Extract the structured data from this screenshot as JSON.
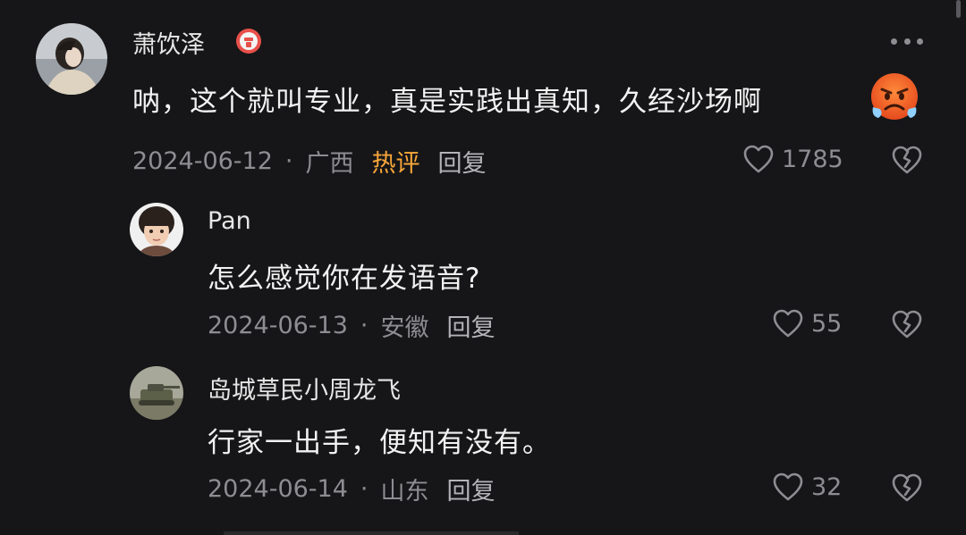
{
  "comments": [
    {
      "username": "萧饮泽",
      "text": "呐，这个就叫专业，真是实践出真知，久经沙场啊",
      "emoji": "angry-face-emoji",
      "date": "2024-06-12",
      "separator": "·",
      "location": "广西",
      "hot_label": "热评",
      "reply_label": "回复",
      "likes": "1785"
    },
    {
      "username": "Pan",
      "text": "怎么感觉你在发语音?",
      "date": "2024-06-13",
      "separator": "·",
      "location": "安徽",
      "reply_label": "回复",
      "likes": "55"
    },
    {
      "username": "岛城草民小周龙飞",
      "text": "行家一出手，便知有没有。",
      "date": "2024-06-14",
      "separator": "·",
      "location": "山东",
      "reply_label": "回复",
      "likes": "32"
    }
  ],
  "colors": {
    "background": "#161618",
    "hot": "#f7a63a",
    "meta": "#8d8d92"
  }
}
